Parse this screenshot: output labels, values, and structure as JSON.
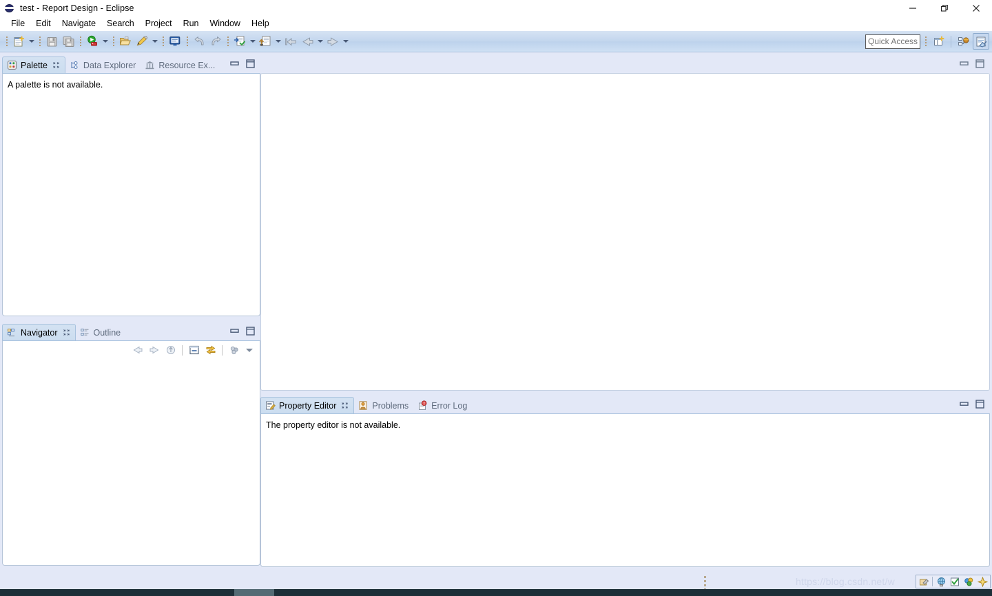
{
  "window": {
    "title": "test - Report Design - Eclipse",
    "app_icon": "eclipse-globe-icon",
    "controls": {
      "minimize": "minimize-button",
      "restore": "restore-button",
      "close": "close-button"
    }
  },
  "menubar": {
    "items": [
      {
        "label": "File"
      },
      {
        "label": "Edit"
      },
      {
        "label": "Navigate"
      },
      {
        "label": "Search"
      },
      {
        "label": "Project"
      },
      {
        "label": "Run"
      },
      {
        "label": "Window"
      },
      {
        "label": "Help"
      }
    ]
  },
  "toolbar": {
    "buttons": [
      {
        "name": "new-report-icon",
        "has_dropdown": true
      },
      {
        "name": "save-icon",
        "has_dropdown": false
      },
      {
        "name": "save-all-icon",
        "has_dropdown": false
      },
      {
        "name": "run-icon",
        "has_dropdown": true
      },
      {
        "name": "open-folder-icon",
        "has_dropdown": false
      },
      {
        "name": "preview-pen-icon",
        "has_dropdown": true
      },
      {
        "name": "monitor-icon",
        "has_dropdown": false
      },
      {
        "name": "undo-icon",
        "has_dropdown": false
      },
      {
        "name": "redo-icon",
        "has_dropdown": false
      },
      {
        "name": "export-icon",
        "has_dropdown": true
      },
      {
        "name": "import-icon",
        "has_dropdown": true
      },
      {
        "name": "back-history-icon",
        "has_dropdown": false
      },
      {
        "name": "back-arrow-icon",
        "has_dropdown": true
      },
      {
        "name": "forward-arrow-icon",
        "has_dropdown": true
      }
    ],
    "quick_access": {
      "value": "",
      "placeholder": "Quick Access"
    },
    "perspective": {
      "open_perspective": "open-perspective-icon",
      "perspective_java": "perspective-java-icon",
      "perspective_report_design": "perspective-report-design-icon"
    }
  },
  "panels": {
    "palette": {
      "tabs": [
        {
          "label": "Palette",
          "icon": "palette-icon",
          "active": true,
          "closable": true
        },
        {
          "label": "Data Explorer",
          "icon": "data-explorer-icon",
          "active": false,
          "closable": false
        },
        {
          "label": "Resource Ex...",
          "icon": "resource-explorer-icon",
          "active": false,
          "closable": false
        }
      ],
      "content": "A palette is not available.",
      "minimize": "minimize-palette-button",
      "maximize": "maximize-palette-button"
    },
    "navigator": {
      "tabs": [
        {
          "label": "Navigator",
          "icon": "navigator-icon",
          "active": true,
          "closable": true
        },
        {
          "label": "Outline",
          "icon": "outline-icon",
          "active": false,
          "closable": false
        }
      ],
      "content": "",
      "minimize": "minimize-navigator-button",
      "maximize": "maximize-navigator-button",
      "view_toolbar": [
        {
          "name": "back-navigation-icon"
        },
        {
          "name": "forward-navigation-icon"
        },
        {
          "name": "up-to-parent-icon"
        },
        {
          "name": "collapse-all-icon"
        },
        {
          "name": "link-with-editor-icon"
        },
        {
          "name": "view-menu-filter-icon"
        },
        {
          "name": "view-menu-chevron-icon"
        }
      ]
    },
    "editor": {
      "content": "",
      "minimize": "minimize-editor-button",
      "maximize": "maximize-editor-button"
    },
    "property_editor": {
      "tabs": [
        {
          "label": "Property Editor",
          "icon": "property-editor-icon",
          "active": true,
          "closable": true
        },
        {
          "label": "Problems",
          "icon": "problems-icon",
          "active": false,
          "closable": false
        },
        {
          "label": "Error Log",
          "icon": "error-log-icon",
          "active": false,
          "closable": false
        }
      ],
      "content": "The property editor is not available.",
      "minimize": "minimize-property-editor-button",
      "maximize": "maximize-property-editor-button"
    }
  },
  "statusbar": {
    "watermark": "https://blog.csdn.net/w",
    "icons": [
      {
        "name": "status-build-icon"
      },
      {
        "name": "status-globe-icon"
      },
      {
        "name": "status-validate-icon"
      },
      {
        "name": "status-palette-icon"
      },
      {
        "name": "status-compass-icon"
      }
    ]
  },
  "colors": {
    "toolbar_top": "#d6e3f3",
    "toolbar_bottom": "#cfe0f4",
    "tab_active": "#cbddf0",
    "workbench_bg": "#e3e8f7",
    "panel_bg": "#ffffff",
    "border": "#b5c4d8",
    "taskbar": "#1d2f38",
    "watermark_color": "#cfd6ea"
  }
}
